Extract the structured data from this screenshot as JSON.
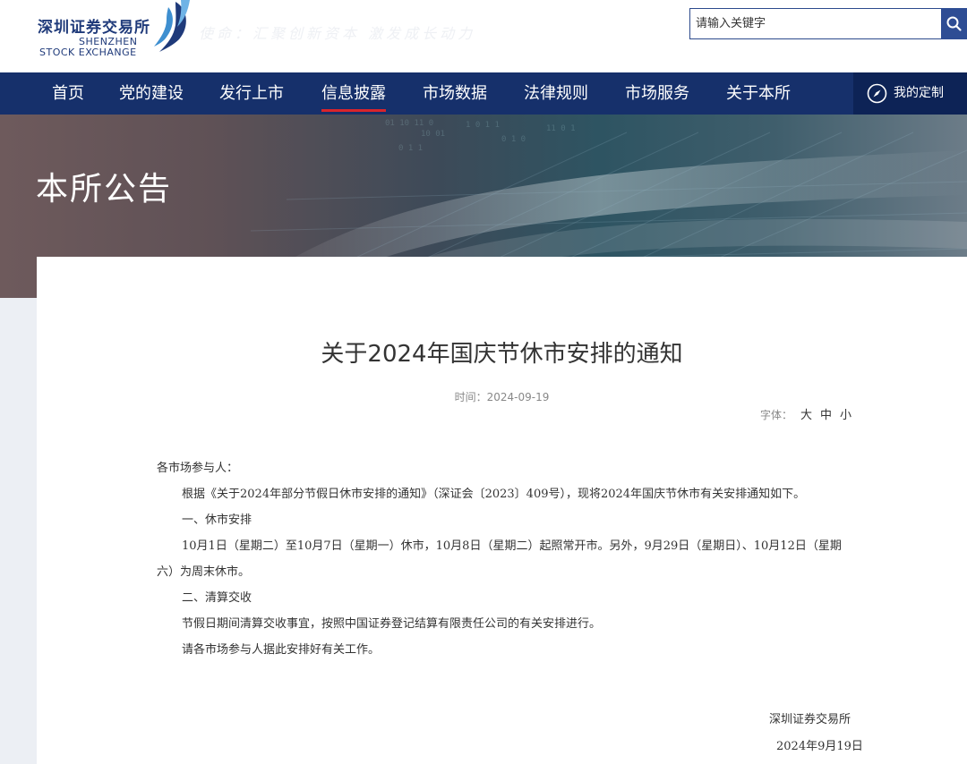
{
  "header": {
    "logo_cn": "深圳证券交易所",
    "logo_en_line1": "SHENZHEN",
    "logo_en_line2": "STOCK EXCHANGE",
    "slogan": "使命：汇聚创新资本 激发成长动力",
    "search_placeholder": "请输入关键字"
  },
  "nav": {
    "items": [
      {
        "label": "首页"
      },
      {
        "label": "党的建设"
      },
      {
        "label": "发行上市"
      },
      {
        "label": "信息披露",
        "active": true
      },
      {
        "label": "市场数据"
      },
      {
        "label": "法律规则"
      },
      {
        "label": "市场服务"
      },
      {
        "label": "关于本所"
      }
    ],
    "custom_label": "我的定制"
  },
  "banner": {
    "title": "本所公告"
  },
  "article": {
    "title": "关于2024年国庆节休市安排的通知",
    "time": "时间：2024-09-19",
    "font_size_label": "字体：",
    "font_sizes": [
      "大",
      "中",
      "小"
    ],
    "salutation": "各市场参与人：",
    "paragraphs": [
      "根据《关于2024年部分节假日休市安排的通知》（深证会〔2023〕409号），现将2024年国庆节休市有关安排通知如下。",
      "一、休市安排",
      "10月1日（星期二）至10月7日（星期一）休市，10月8日（星期二）起照常开市。另外，9月29日（星期日）、10月12日（星期六）为周末休市。",
      "二、清算交收",
      "节假日期间清算交收事宜，按照中国证券登记结算有限责任公司的有关安排进行。",
      "请各市场参与人据此安排好有关工作。"
    ],
    "signature_org": "深圳证券交易所",
    "signature_date": "2024年9月19日"
  },
  "colors": {
    "nav_bg": "#16306b",
    "nav_active_underline": "#d9242c",
    "brand_blue": "#1f3a7a",
    "search_button": "#2e4d94"
  }
}
